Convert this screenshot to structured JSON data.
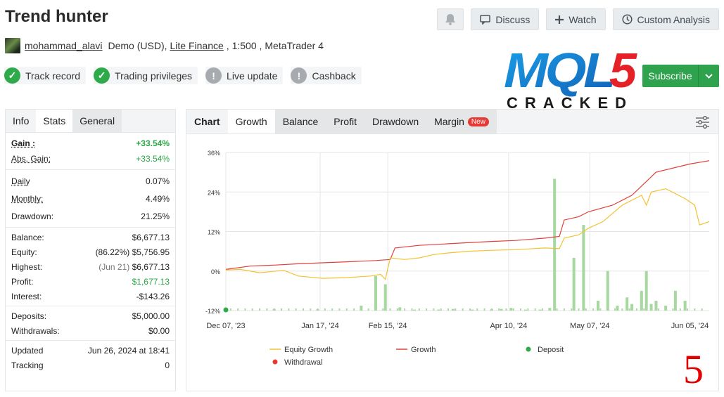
{
  "page": {
    "title": "Trend hunter"
  },
  "top_buttons": {
    "discuss": "Discuss",
    "watch": "Watch",
    "custom": "Custom Analysis"
  },
  "user": {
    "name": "mohammad_alavi",
    "account_type": "Demo (USD),",
    "broker": "Lite Finance",
    "leverage": ", 1:500 ,",
    "platform": "MetaTrader 4"
  },
  "badges": [
    {
      "label": "Track record",
      "state": "ok"
    },
    {
      "label": "Trading privileges",
      "state": "ok"
    },
    {
      "label": "Live update",
      "state": "warn"
    },
    {
      "label": "Cashback",
      "state": "warn"
    }
  ],
  "logo": {
    "top": "MQL5",
    "bottom": "CRACKED"
  },
  "subscribe": {
    "label": "Subscribe"
  },
  "left_tabs": [
    "Info",
    "Stats",
    "General"
  ],
  "stats": {
    "gain_label": "Gain :",
    "gain": "+33.54%",
    "abs_gain_label": "Abs. Gain:",
    "abs_gain": "+33.54%",
    "daily_label": "Daily",
    "daily": "0.07%",
    "monthly_label": "Monthly:",
    "monthly": "4.49%",
    "drawdown_label": "Drawdown:",
    "drawdown": "21.25%",
    "balance_label": "Balance:",
    "balance": "$6,677.13",
    "equity_label": "Equity:",
    "equity_pct": "(86.22%)",
    "equity": "$5,756.95",
    "highest_label": "Highest:",
    "highest_date": "(Jun 21)",
    "highest": "$6,677.13",
    "profit_label": "Profit:",
    "profit": "$1,677.13",
    "interest_label": "Interest:",
    "interest": "-$143.26",
    "deposits_label": "Deposits:",
    "deposits": "$5,000.00",
    "withdrawals_label": "Withdrawals:",
    "withdrawals": "$0.00",
    "updated_label": "Updated",
    "updated": "Jun 26, 2024 at 18:41",
    "tracking_label": "Tracking",
    "tracking": "0"
  },
  "chart_tabs": {
    "label": "Chart",
    "items": [
      "Growth",
      "Balance",
      "Profit",
      "Drawdown",
      "Margin"
    ],
    "new_badge": "New"
  },
  "watermark_number": "5",
  "chart_data": {
    "type": "line",
    "ylim": [
      -12,
      36
    ],
    "yticks": [
      "36%",
      "24%",
      "12%",
      "0%",
      "-12%"
    ],
    "ytick_values": [
      36,
      24,
      12,
      0,
      -12
    ],
    "xticks": [
      "Dec 07, '23",
      "Jan 17, '24",
      "Feb 15, '24",
      "Apr 10, '24",
      "May 07, '24",
      "Jun 05, '24"
    ],
    "xlim": [
      0,
      100
    ],
    "xtick_positions": [
      0,
      19.5,
      33.5,
      58.5,
      75.3,
      96
    ],
    "legend": [
      "Equity Growth",
      "Growth",
      "Deposit",
      "Withdrawal"
    ],
    "colors": {
      "equity": "#f2c230",
      "growth": "#e0403a",
      "deposit": "#2eaa4b",
      "withdrawal": "#e53935",
      "bars": "#a7d8a0"
    },
    "series": [
      {
        "name": "Growth",
        "points": [
          [
            0,
            0.5
          ],
          [
            5,
            1.5
          ],
          [
            10,
            1.8
          ],
          [
            15,
            2.2
          ],
          [
            20,
            2.5
          ],
          [
            25,
            2.8
          ],
          [
            31,
            3.2
          ],
          [
            34,
            3.5
          ],
          [
            35,
            7
          ],
          [
            40,
            7.8
          ],
          [
            45,
            8.2
          ],
          [
            50,
            8.6
          ],
          [
            55,
            9
          ],
          [
            60,
            9.3
          ],
          [
            66,
            10
          ],
          [
            69,
            10.5
          ],
          [
            70,
            15.5
          ],
          [
            73,
            16.5
          ],
          [
            75,
            18
          ],
          [
            80,
            20
          ],
          [
            84,
            23
          ],
          [
            89,
            30
          ],
          [
            96,
            32.5
          ],
          [
            100,
            33.5
          ]
        ]
      },
      {
        "name": "Equity Growth",
        "points": [
          [
            0,
            0.3
          ],
          [
            3,
            0.5
          ],
          [
            7,
            -0.5
          ],
          [
            12,
            0.2
          ],
          [
            15,
            -1.5
          ],
          [
            20,
            -2.2
          ],
          [
            25,
            -2
          ],
          [
            30,
            -1.5
          ],
          [
            32,
            -1
          ],
          [
            33,
            -2.5
          ],
          [
            34,
            4
          ],
          [
            37,
            3.5
          ],
          [
            40,
            4
          ],
          [
            43,
            5
          ],
          [
            46,
            5.5
          ],
          [
            50,
            6
          ],
          [
            55,
            6.3
          ],
          [
            60,
            6.5
          ],
          [
            66,
            7
          ],
          [
            69,
            6.8
          ],
          [
            70,
            10
          ],
          [
            73,
            11
          ],
          [
            75,
            13
          ],
          [
            78,
            15
          ],
          [
            82,
            20
          ],
          [
            86,
            23
          ],
          [
            87,
            20
          ],
          [
            88,
            24
          ],
          [
            91,
            25
          ],
          [
            95,
            22
          ],
          [
            97,
            20
          ],
          [
            98,
            14
          ],
          [
            100,
            15
          ]
        ]
      },
      {
        "name": "Volume",
        "type": "bar",
        "points": [
          [
            10,
            0.5
          ],
          [
            19,
            0.4
          ],
          [
            28,
            1.5
          ],
          [
            31,
            10.5
          ],
          [
            33,
            8
          ],
          [
            36,
            1
          ],
          [
            39,
            0.3
          ],
          [
            44,
            0.3
          ],
          [
            47,
            0.5
          ],
          [
            51,
            0.3
          ],
          [
            55,
            0.4
          ],
          [
            57,
            0.5
          ],
          [
            59,
            0.8
          ],
          [
            62,
            0.3
          ],
          [
            65,
            0.3
          ],
          [
            67,
            0.8
          ],
          [
            68,
            40
          ],
          [
            72,
            16
          ],
          [
            74,
            26
          ],
          [
            77,
            3
          ],
          [
            79,
            12
          ],
          [
            81,
            1.5
          ],
          [
            83,
            4
          ],
          [
            84,
            2
          ],
          [
            86,
            6
          ],
          [
            87,
            12
          ],
          [
            88,
            2
          ],
          [
            89,
            3
          ],
          [
            91,
            1.5
          ],
          [
            93,
            6
          ],
          [
            95,
            3
          ]
        ]
      }
    ]
  }
}
